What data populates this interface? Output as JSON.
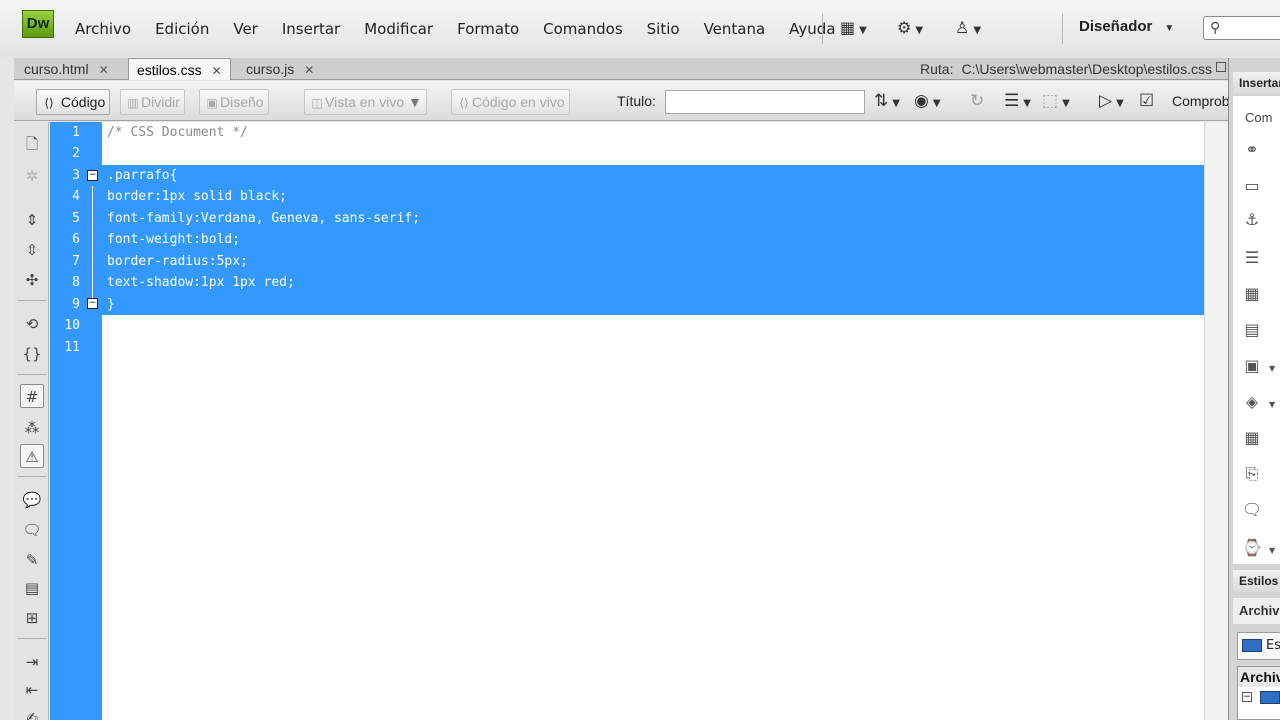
{
  "app": {
    "logo": "Dw",
    "menu": [
      "Archivo",
      "Edición",
      "Ver",
      "Insertar",
      "Modificar",
      "Formato",
      "Comandos",
      "Sitio",
      "Ventana",
      "Ayuda"
    ],
    "workspace": "Diseñador",
    "search_placeholder": "",
    "icons": [
      "layout-icon",
      "gear-icon",
      "sitemap-icon",
      "search-icon"
    ]
  },
  "tabs": [
    {
      "label": "curso.html",
      "active": false
    },
    {
      "label": "estilos.css",
      "active": true
    },
    {
      "label": "curso.js",
      "active": false
    }
  ],
  "path": {
    "label": "Ruta:",
    "value": "C:\\Users\\webmaster\\Desktop\\estilos.css"
  },
  "doc_toolbar": {
    "code_button": "Código",
    "split_button": "Dividir",
    "design_button": "Diseño",
    "live_view_button": "Vista en vivo",
    "live_code_button": "Código en vivo",
    "title_label": "Título:",
    "title_value": "",
    "check_label": "Comprob"
  },
  "editor": {
    "line_numbers": [
      "1",
      "2",
      "3",
      "4",
      "5",
      "6",
      "7",
      "8",
      "9",
      "10",
      "11"
    ],
    "lines": [
      "/* CSS Document */",
      "",
      ".parrafo{",
      "border:1px solid black;",
      "font-family:Verdana, Geneva, sans-serif;",
      "font-weight:bold;",
      "border-radius:5px;",
      "text-shadow:1px 1px red;",
      "}",
      "",
      ""
    ],
    "selected_lines": [
      3,
      9
    ],
    "selection_color": "#3399ff"
  },
  "panels": {
    "insert_header": "Insertar",
    "insert_category": "Com",
    "styles_header": "Estilos",
    "files_tab": "Archivos",
    "site_select": "Es",
    "files_header": "Archivos"
  }
}
